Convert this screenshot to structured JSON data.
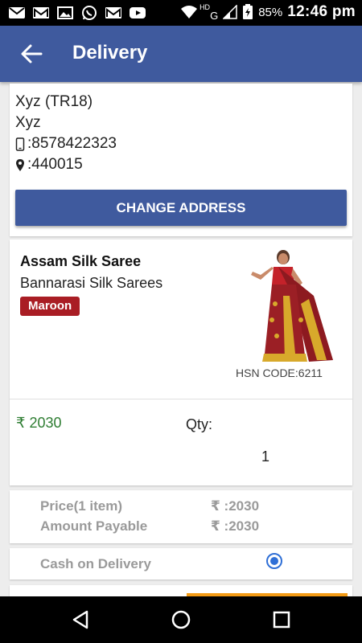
{
  "status_bar": {
    "battery_pct": "85%",
    "time": "12:46 pm",
    "network_hd": "HD",
    "network_g": "G",
    "notification_icons": [
      "mail-icon",
      "gmail-icon",
      "image-icon",
      "whatsapp-icon",
      "gmail-icon",
      "youtube-icon"
    ]
  },
  "app_bar": {
    "title": "Delivery",
    "back_icon": "back-arrow-icon"
  },
  "address": {
    "name": "Xyz (TR18)",
    "line2": "Xyz",
    "phone": ":8578422323",
    "pincode": ":440015",
    "change_button": "CHANGE ADDRESS"
  },
  "product": {
    "name": "Assam Silk Saree",
    "category": "Bannarasi Silk Sarees",
    "color": "Maroon",
    "hsn": "HSN CODE:6211",
    "currency_symbol": "₹",
    "price": "2030",
    "qty_label": "Qty:",
    "qty_value": "1"
  },
  "summary": {
    "price_label": "Price(1 item)",
    "price_value": "₹ :2030",
    "payable_label": "Amount Payable",
    "payable_value": "₹ :2030"
  },
  "payment": {
    "cod_label": "Cash on Delivery",
    "cod_selected": true
  },
  "colors": {
    "app_bar": "#3f5a9e",
    "badge": "#a91d24",
    "price_green": "#2e7d32",
    "radio": "#2f6fd6",
    "accent_orange": "#f29a14"
  }
}
